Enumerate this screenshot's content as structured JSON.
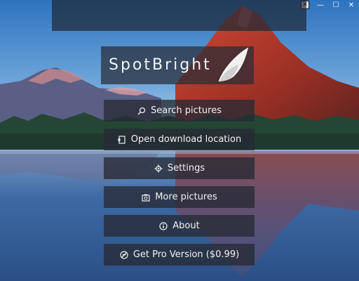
{
  "app": {
    "name": "SpotBright"
  },
  "window_controls": {
    "minimize": "—",
    "maximize": "☐",
    "close": "✕",
    "close_box": "✕"
  },
  "menu": {
    "items": [
      {
        "label": "Search pictures",
        "icon": "search-icon"
      },
      {
        "label": "Open download location",
        "icon": "folder-icon"
      },
      {
        "label": "Settings",
        "icon": "gear-icon"
      },
      {
        "label": "More pictures",
        "icon": "camera-icon"
      },
      {
        "label": "About",
        "icon": "info-icon"
      },
      {
        "label": "Get Pro Version ($0.99)",
        "icon": "no-ads-icon"
      }
    ]
  },
  "colors": {
    "sky_top": "#2f76c2",
    "sky_bottom": "#b4d3ee",
    "mountain_red": "#b23a2a",
    "water": "#3a5f95",
    "panel": "#262a34"
  }
}
